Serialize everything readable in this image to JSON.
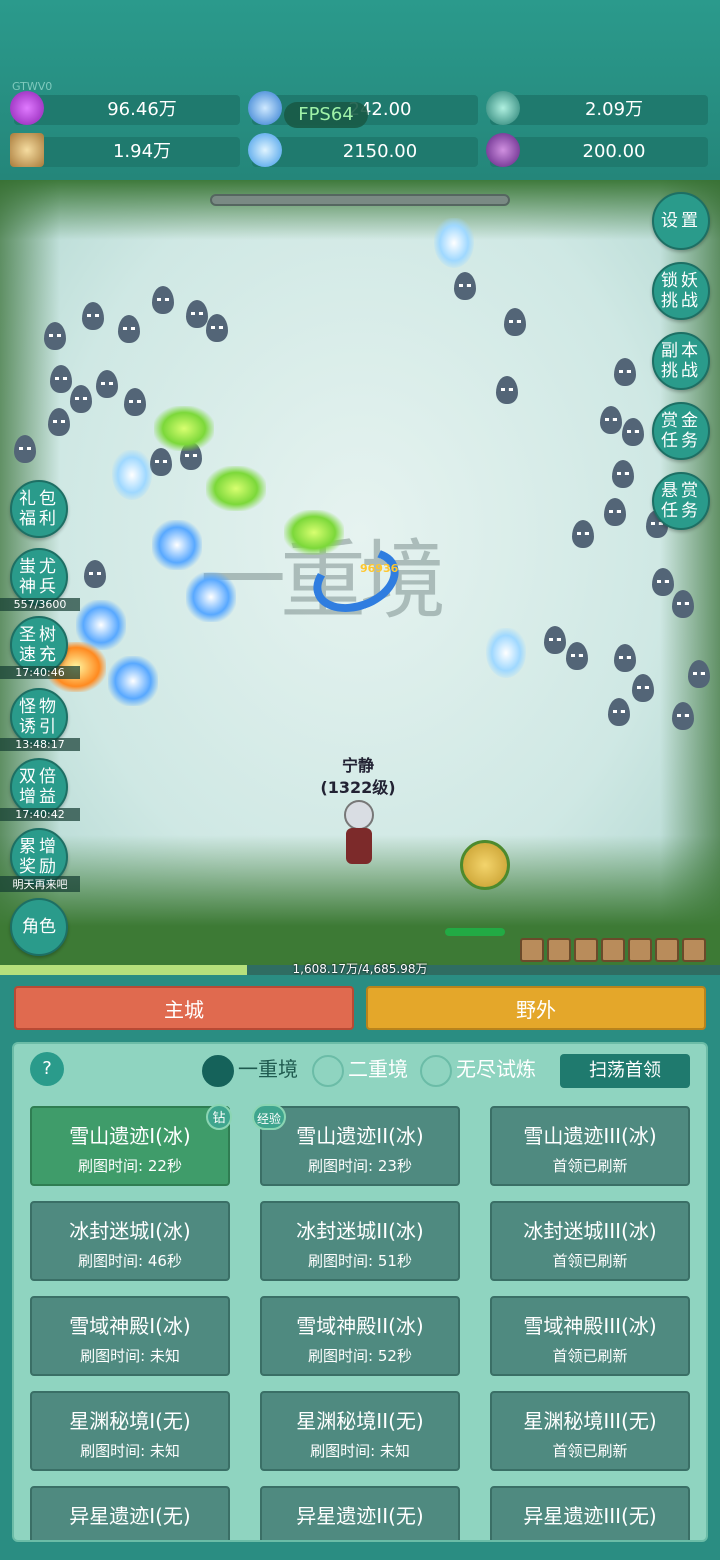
{
  "version": "GTWV0",
  "fps": "FPS64",
  "resources": [
    {
      "icon": "diamond-icon",
      "value": "96.46万",
      "color": "#b040d0"
    },
    {
      "icon": "crystal-icon",
      "value": "242.00",
      "color": "#3aa0ff"
    },
    {
      "icon": "orb-icon",
      "value": "2.09万",
      "color": "#2aa090"
    },
    {
      "icon": "book-icon",
      "value": "1.94万",
      "color": "#c89850"
    },
    {
      "icon": "ice-shard-icon",
      "value": "2150.00",
      "color": "#5ab8ff"
    },
    {
      "icon": "grape-icon",
      "value": "200.00",
      "color": "#7a3aa0"
    }
  ],
  "field": {
    "watermark": "一重境",
    "damage": "96936",
    "hero_name": "宁静",
    "hero_level": "(1322级)",
    "exp_text": "1,608.17万/4,685.98万",
    "exp_fraction": 0.343
  },
  "right_buttons": [
    "设置",
    "锁妖挑战",
    "副本挑战",
    "赏金任务",
    "悬赏任务"
  ],
  "left_buttons": [
    {
      "label": "礼包福利",
      "sub": ""
    },
    {
      "label": "蚩尤神兵",
      "sub": "557/3600"
    },
    {
      "label": "圣树速充",
      "sub": "17:40:46"
    },
    {
      "label": "怪物诱引",
      "sub": "13:48:17"
    },
    {
      "label": "双倍增益",
      "sub": "17:40:42"
    },
    {
      "label": "累增奖励",
      "sub": "明天再来吧"
    },
    {
      "label": "角色",
      "sub": ""
    }
  ],
  "tabs": {
    "city": "主城",
    "wild": "野外"
  },
  "panel": {
    "help": "?",
    "realms": [
      "一重境",
      "二重境",
      "无尽试炼"
    ],
    "sweep": "扫荡首领",
    "tag_diamond": "钻",
    "tag_exp": "经验",
    "maps": [
      {
        "name": "雪山遗迹I(冰)",
        "time": "刷图时间: 22秒"
      },
      {
        "name": "雪山遗迹II(冰)",
        "time": "刷图时间: 23秒"
      },
      {
        "name": "雪山遗迹III(冰)",
        "time": "首领已刷新"
      },
      {
        "name": "冰封迷城I(冰)",
        "time": "刷图时间: 46秒"
      },
      {
        "name": "冰封迷城II(冰)",
        "time": "刷图时间: 51秒"
      },
      {
        "name": "冰封迷城III(冰)",
        "time": "首领已刷新"
      },
      {
        "name": "雪域神殿I(冰)",
        "time": "刷图时间: 未知"
      },
      {
        "name": "雪域神殿II(冰)",
        "time": "刷图时间: 52秒"
      },
      {
        "name": "雪域神殿III(冰)",
        "time": "首领已刷新"
      },
      {
        "name": "星渊秘境I(无)",
        "time": "刷图时间: 未知"
      },
      {
        "name": "星渊秘境II(无)",
        "time": "刷图时间: 未知"
      },
      {
        "name": "星渊秘境III(无)",
        "time": "首领已刷新"
      },
      {
        "name": "异星遗迹I(无)",
        "time": ""
      },
      {
        "name": "异星遗迹II(无)",
        "time": ""
      },
      {
        "name": "异星遗迹III(无)",
        "time": ""
      }
    ]
  }
}
